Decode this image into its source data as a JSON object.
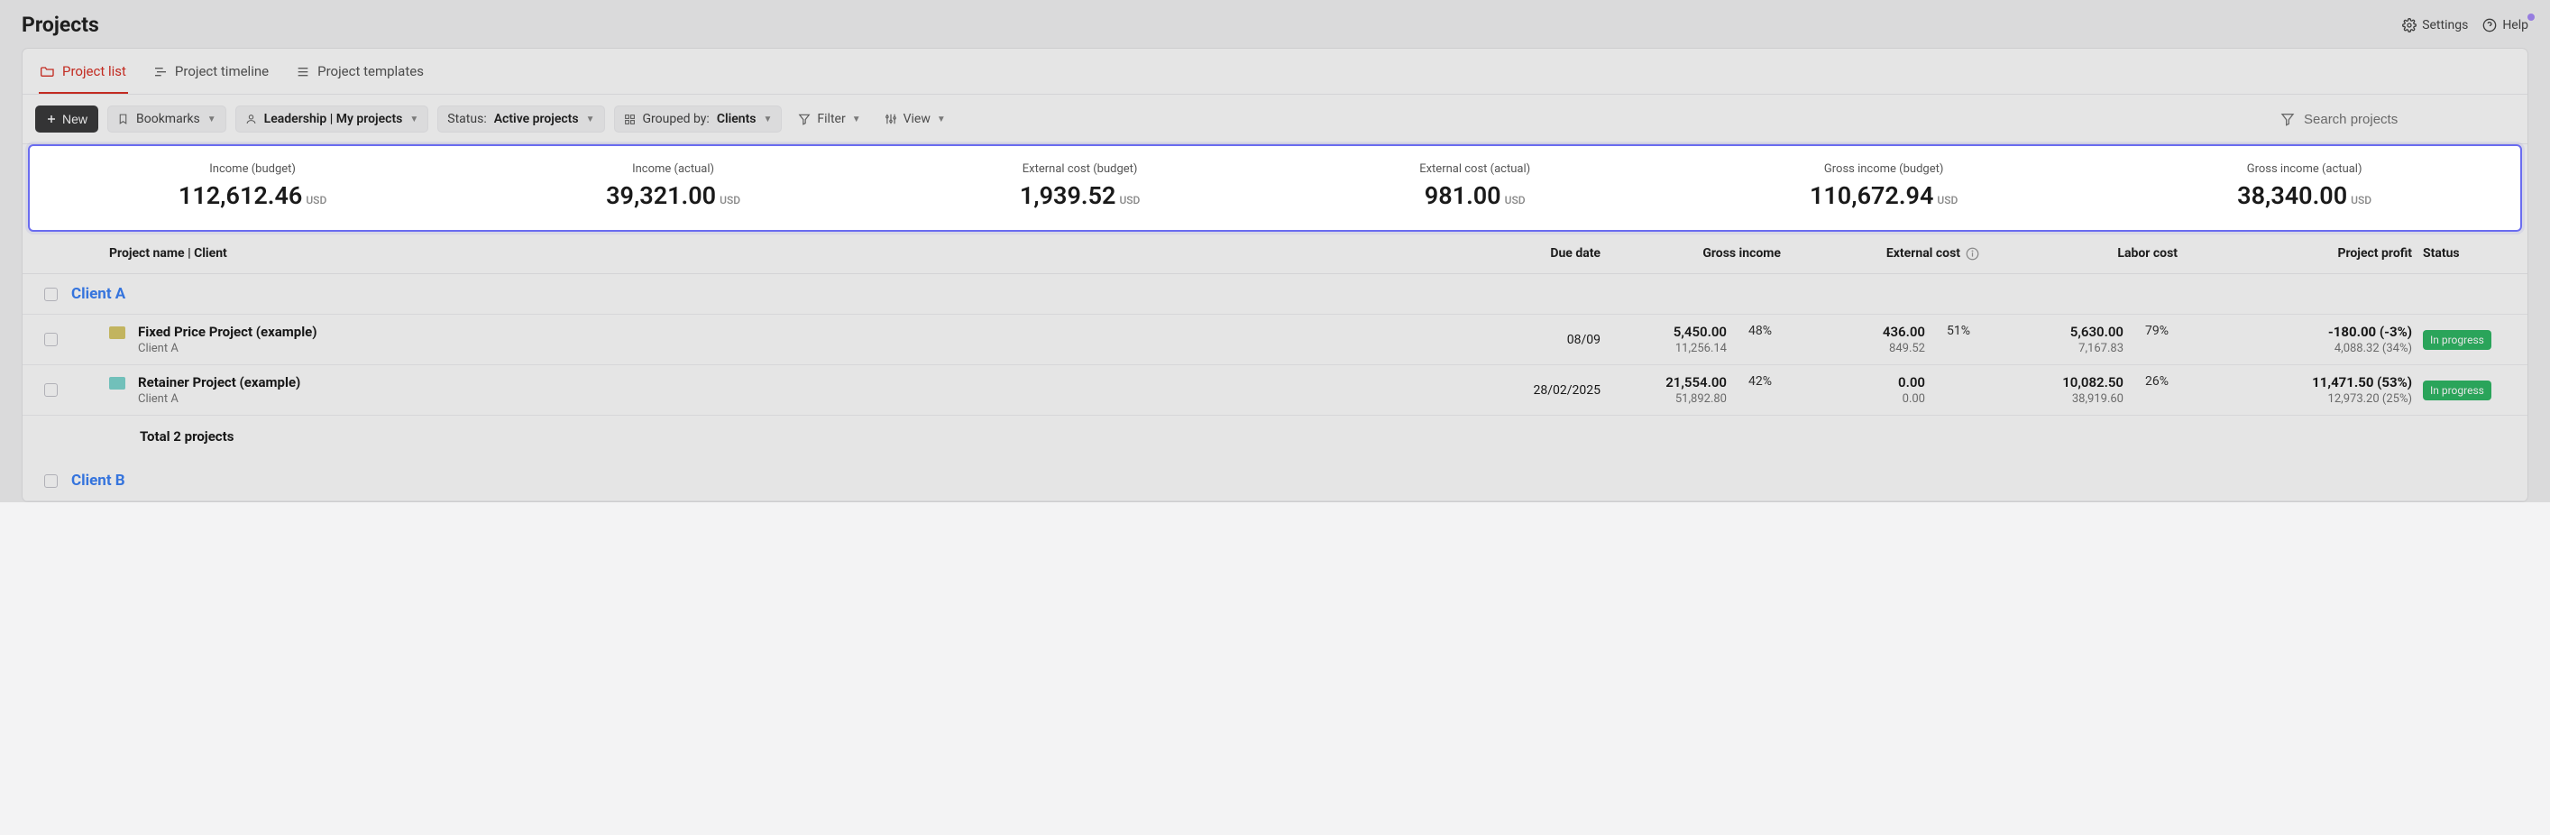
{
  "page": {
    "title": "Projects"
  },
  "top": {
    "settings": "Settings",
    "help": "Help"
  },
  "tabs": {
    "list": "Project list",
    "timeline": "Project timeline",
    "templates": "Project templates"
  },
  "toolbar": {
    "new": "New",
    "bookmarks": "Bookmarks",
    "scope": "Leadership | My projects",
    "status_prefix": "Status: ",
    "status_value": "Active projects",
    "group_prefix": "Grouped by: ",
    "group_value": "Clients",
    "filter": "Filter",
    "view": "View",
    "search_placeholder": "Search projects"
  },
  "stats": {
    "currency": "USD",
    "items": [
      {
        "label": "Income (budget)",
        "value": "112,612.46"
      },
      {
        "label": "Income (actual)",
        "value": "39,321.00"
      },
      {
        "label": "External cost (budget)",
        "value": "1,939.52"
      },
      {
        "label": "External cost (actual)",
        "value": "981.00"
      },
      {
        "label": "Gross income (budget)",
        "value": "110,672.94"
      },
      {
        "label": "Gross income (actual)",
        "value": "38,340.00"
      }
    ]
  },
  "columns": {
    "project": "Project name | Client",
    "due": "Due date",
    "gross": "Gross income",
    "external": "External cost",
    "labor": "Labor cost",
    "profit": "Project profit",
    "status": "Status"
  },
  "groups": [
    {
      "name": "Client A",
      "rows": [
        {
          "folder_color": "yellow",
          "name": "Fixed Price Project (example)",
          "client": "Client A",
          "due": "08/09",
          "gross_main": "5,450.00",
          "gross_sub": "11,256.14",
          "gross_pct": "48%",
          "ext_main": "436.00",
          "ext_sub": "849.52",
          "ext_pct": "51%",
          "labor_main": "5,630.00",
          "labor_sub": "7,167.83",
          "labor_pct": "79%",
          "profit_main": "-180.00 (-3%)",
          "profit_sub": "4,088.32 (34%)",
          "status": "In progress"
        },
        {
          "folder_color": "teal",
          "name": "Retainer Project (example)",
          "client": "Client A",
          "due": "28/02/2025",
          "gross_main": "21,554.00",
          "gross_sub": "51,892.80",
          "gross_pct": "42%",
          "ext_main": "0.00",
          "ext_sub": "0.00",
          "ext_pct": "",
          "labor_main": "10,082.50",
          "labor_sub": "38,919.60",
          "labor_pct": "26%",
          "profit_main": "11,471.50 (53%)",
          "profit_sub": "12,973.20 (25%)",
          "status": "In progress"
        }
      ],
      "total": "Total 2 projects"
    },
    {
      "name": "Client B",
      "rows": [],
      "total": ""
    }
  ]
}
